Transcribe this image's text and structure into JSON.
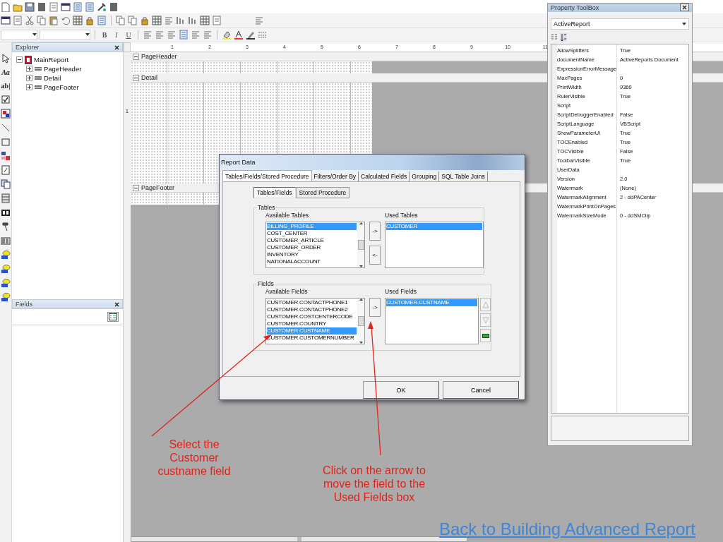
{
  "format_buttons": [
    {
      "label": "B",
      "kind": "bold"
    },
    {
      "label": "I",
      "kind": "italic"
    },
    {
      "label": "U",
      "kind": "underline"
    }
  ],
  "palette": [
    {
      "kind": "pointer"
    },
    {
      "kind": "text",
      "label": "Aa"
    },
    {
      "kind": "text",
      "label": "ab|"
    },
    {
      "kind": "checkbox"
    },
    {
      "kind": "image"
    },
    {
      "kind": "line"
    },
    {
      "kind": "rectangle"
    },
    {
      "kind": "grid"
    },
    {
      "kind": "page"
    },
    {
      "kind": "pages"
    },
    {
      "kind": "lines"
    },
    {
      "kind": "ole"
    },
    {
      "kind": "hammer"
    },
    {
      "kind": "barcode"
    },
    {
      "kind": "database"
    },
    {
      "kind": "database"
    },
    {
      "kind": "database"
    },
    {
      "kind": "database"
    }
  ],
  "explorer": {
    "title": "Explorer",
    "tree": [
      {
        "label": "MainReport",
        "kind": "report",
        "expanded": true,
        "children": [
          {
            "label": "PageHeader",
            "kind": "section",
            "expanded": false
          },
          {
            "label": "Detail",
            "kind": "section",
            "expanded": false
          },
          {
            "label": "PageFooter",
            "kind": "section",
            "expanded": false
          }
        ]
      }
    ]
  },
  "fields_panel": {
    "title": "Fields"
  },
  "ruler": {
    "horizontal": [
      "1",
      "2",
      "3",
      "4",
      "5",
      "6",
      "7",
      "8",
      "9",
      "10",
      "11"
    ],
    "vertical": [
      "1"
    ]
  },
  "sections": [
    {
      "label": "PageHeader",
      "kind": "short",
      "expanded": true
    },
    {
      "label": "Detail",
      "kind": "tall",
      "expanded": true
    },
    {
      "label": "PageFooter",
      "kind": "short",
      "expanded": true
    }
  ],
  "dialog": {
    "title": "Report Data",
    "tabs": [
      {
        "label": "Tables/Fields/Stored Procedure",
        "selected": true
      },
      {
        "label": "Filters/Order By",
        "selected": false
      },
      {
        "label": "Calculated Fields",
        "selected": false
      },
      {
        "label": "Grouping",
        "selected": false
      },
      {
        "label": "SQL Table Joins",
        "selected": false
      }
    ],
    "subtabs": [
      {
        "label": "Tables/Fields",
        "selected": true
      },
      {
        "label": "Stored Procedure",
        "selected": false
      }
    ],
    "groups": [
      {
        "title": "Tables",
        "available_label": "Available Tables",
        "used_label": "Used Tables",
        "move_buttons": [
          "->",
          "<-"
        ],
        "available": [
          {
            "text": "BILLING_PROFILE",
            "selected": true
          },
          {
            "text": "COST_CENTER",
            "selected": false
          },
          {
            "text": "CUSTOMER_ARTICLE",
            "selected": false
          },
          {
            "text": "CUSTOMER_ORDER",
            "selected": false
          },
          {
            "text": "INVENTORY",
            "selected": false
          },
          {
            "text": "NATIONALACCOUNT",
            "selected": false
          }
        ],
        "used": [
          {
            "text": "CUSTOMER",
            "selected": true
          }
        ]
      },
      {
        "title": "Fields",
        "available_label": "Available Fields",
        "used_label": "Used Fields",
        "move_buttons": [
          "->"
        ],
        "order_buttons": [
          {
            "kind": "up"
          },
          {
            "kind": "down"
          },
          {
            "kind": "remove"
          }
        ],
        "available": [
          {
            "text": "CUSTOMER.CONTACTPHONE1",
            "selected": false
          },
          {
            "text": "CUSTOMER.CONTACTPHONE2",
            "selected": false
          },
          {
            "text": "CUSTOMER.COSTCENTERCODE",
            "selected": false
          },
          {
            "text": "CUSTOMER.COUNTRY",
            "selected": false
          },
          {
            "text": "CUSTOMER.CUSTNAME",
            "selected": true
          },
          {
            "text": "CUSTOMER.CUSTOMERNUMBER",
            "selected": false
          }
        ],
        "used": [
          {
            "text": "CUSTOMER.CUSTNAME",
            "selected": true
          }
        ]
      }
    ],
    "buttons": [
      "OK",
      "Cancel"
    ]
  },
  "property_toolbox": {
    "title": "Property ToolBox",
    "object": "ActiveReport",
    "properties": [
      {
        "name": "AllowSplitters",
        "value": "True"
      },
      {
        "name": "documentName",
        "value": "ActiveReports Document"
      },
      {
        "name": "ExpressionErrorMessage"
      },
      {
        "name": "MaxPages",
        "value": "0"
      },
      {
        "name": "PrintWidth",
        "value": "9360"
      },
      {
        "name": "RulerVisible",
        "value": "True"
      },
      {
        "name": "Script"
      },
      {
        "name": "ScriptDebuggerEnabled",
        "value": "False"
      },
      {
        "name": "ScriptLanguage",
        "value": "VBScript"
      },
      {
        "name": "ShowParameterUI",
        "value": "True"
      },
      {
        "name": "TOCEnabled",
        "value": "True"
      },
      {
        "name": "TOCVisible",
        "value": "False"
      },
      {
        "name": "ToolbarVisible",
        "value": "True"
      },
      {
        "name": "UserData"
      },
      {
        "name": "Version",
        "value": "2.0"
      },
      {
        "name": "Watermark",
        "value": "(None)"
      },
      {
        "name": "WatermarkAlignment",
        "value": "2 - ddPACenter"
      },
      {
        "name": "WatermarkPrintOnPages"
      },
      {
        "name": "WatermarkSizeMode",
        "value": "0 - ddSMClip"
      }
    ]
  },
  "annotations": [
    {
      "text": "Select the Customer custname field",
      "kind": "left"
    },
    {
      "text": "Click on the arrow to move the field to the Used Fields box",
      "kind": "right"
    }
  ],
  "link": "Back to Building Advanced Report"
}
